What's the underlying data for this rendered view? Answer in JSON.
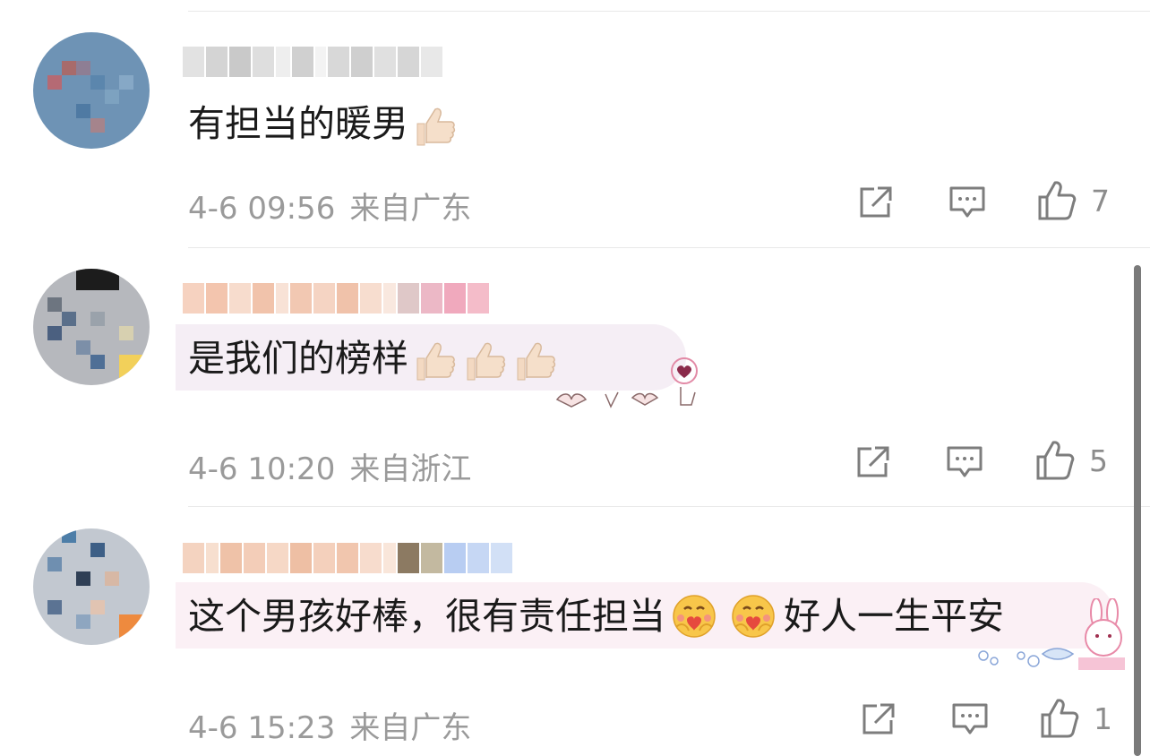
{
  "comments": [
    {
      "text": "有担当的暖男",
      "time": "4-6 09:56",
      "location": "来自广东",
      "likes": "7",
      "emojis": [
        "thumbs-up"
      ]
    },
    {
      "text": "是我们的榜样",
      "time": "4-6 10:20",
      "location": "来自浙江",
      "likes": "5",
      "emojis": [
        "thumbs-up",
        "thumbs-up",
        "thumbs-up"
      ],
      "bubble_color": "#f5eef5"
    },
    {
      "text_part1": "这个男孩好棒，很有责任担当",
      "text_part2": "好人一生平安",
      "time": "4-6 15:23",
      "location": "来自广东",
      "likes": "1",
      "emojis": [
        "hugging-face",
        "hugging-face"
      ],
      "bubble_color": "#fbf0f5"
    }
  ],
  "icons": {
    "share": "share-icon",
    "reply": "comment-icon",
    "like": "thumbs-up-icon"
  },
  "colors": {
    "meta_text": "#9a9a9a",
    "divider": "#e9e9e9",
    "icon_stroke": "#7d7d7d"
  }
}
